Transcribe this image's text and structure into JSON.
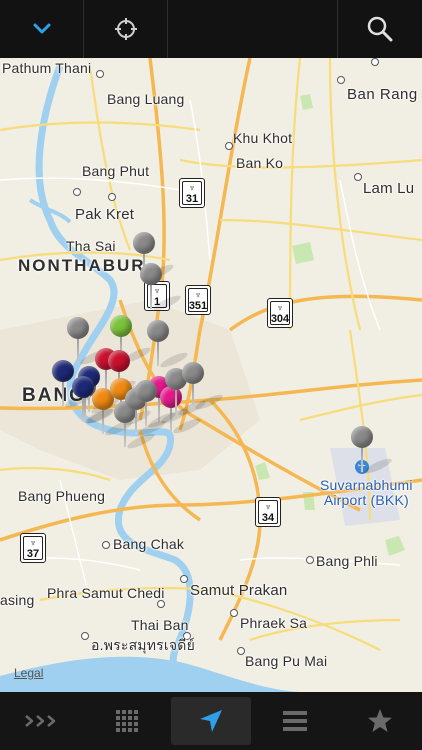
{
  "toolbar": {
    "collapse_icon": "chevron-down-icon",
    "locate_icon": "crosshair-icon",
    "search_icon": "search-icon",
    "accent_color": "#2f9fe8"
  },
  "map": {
    "places": [
      {
        "id": "pathum-thani",
        "label": "Pathum Thani"
      },
      {
        "id": "bang-luang",
        "label": "Bang Luang"
      },
      {
        "id": "ban-rang",
        "label": "Ban Rang"
      },
      {
        "id": "khu-khot",
        "label": "Khu Khot"
      },
      {
        "id": "ban-ko",
        "label": "Ban Ko"
      },
      {
        "id": "bang-phut",
        "label": "Bang Phut"
      },
      {
        "id": "lam-lu",
        "label": "Lam Lu"
      },
      {
        "id": "pak-kret",
        "label": "Pak Kret"
      },
      {
        "id": "tha-sai",
        "label": "Tha Sai"
      },
      {
        "id": "nonthaburi",
        "label": "NONTHABUR"
      },
      {
        "id": "bangkok",
        "label": "BANG"
      },
      {
        "id": "bang-phueng",
        "label": "Bang Phueng"
      },
      {
        "id": "bang-chak",
        "label": "Bang Chak"
      },
      {
        "id": "bang-phli",
        "label": "Bang Phli"
      },
      {
        "id": "phra-samut-chedi",
        "label": "Phra Samut Chedi"
      },
      {
        "id": "samut-prakan",
        "label": "Samut Prakan"
      },
      {
        "id": "thai-ban",
        "label": "Thai Ban"
      },
      {
        "id": "phraek-sa",
        "label": "Phraek Sa"
      },
      {
        "id": "asing",
        "label": "asing"
      },
      {
        "id": "thai-chedi",
        "label": "อ.พระสมุทรเจดีย์"
      },
      {
        "id": "bang-pu-mai",
        "label": "Bang Pu Mai"
      }
    ],
    "airport": {
      "line1": "Suvarnabhumi",
      "line2": "Airport (BKK)"
    },
    "highways": [
      "31",
      "1",
      "351",
      "304",
      "34",
      "37"
    ],
    "legal": "Legal",
    "pin_colors": {
      "gray": "#8a8a8a",
      "green": "#7cc23a",
      "red": "#c8102e",
      "navy": "#1e2a78",
      "orange": "#f08a12",
      "magenta": "#e3198a"
    },
    "pins": [
      {
        "color": "gray"
      },
      {
        "color": "gray"
      },
      {
        "color": "gray"
      },
      {
        "color": "green"
      },
      {
        "color": "gray"
      },
      {
        "color": "navy"
      },
      {
        "color": "red"
      },
      {
        "color": "red"
      },
      {
        "color": "gray"
      },
      {
        "color": "navy"
      },
      {
        "color": "orange"
      },
      {
        "color": "orange"
      },
      {
        "color": "magenta"
      },
      {
        "color": "magenta"
      },
      {
        "color": "gray"
      },
      {
        "color": "gray"
      },
      {
        "color": "gray"
      },
      {
        "color": "gray"
      },
      {
        "color": "navy"
      },
      {
        "color": "gray"
      },
      {
        "color": "gray"
      }
    ]
  },
  "tabbar": {
    "tabs": [
      {
        "id": "forward",
        "icon": "triple-chevron-right-icon"
      },
      {
        "id": "grid",
        "icon": "grid-icon"
      },
      {
        "id": "location",
        "icon": "location-arrow-icon",
        "active": true
      },
      {
        "id": "list",
        "icon": "list-icon"
      },
      {
        "id": "favorites",
        "icon": "star-icon"
      }
    ]
  }
}
